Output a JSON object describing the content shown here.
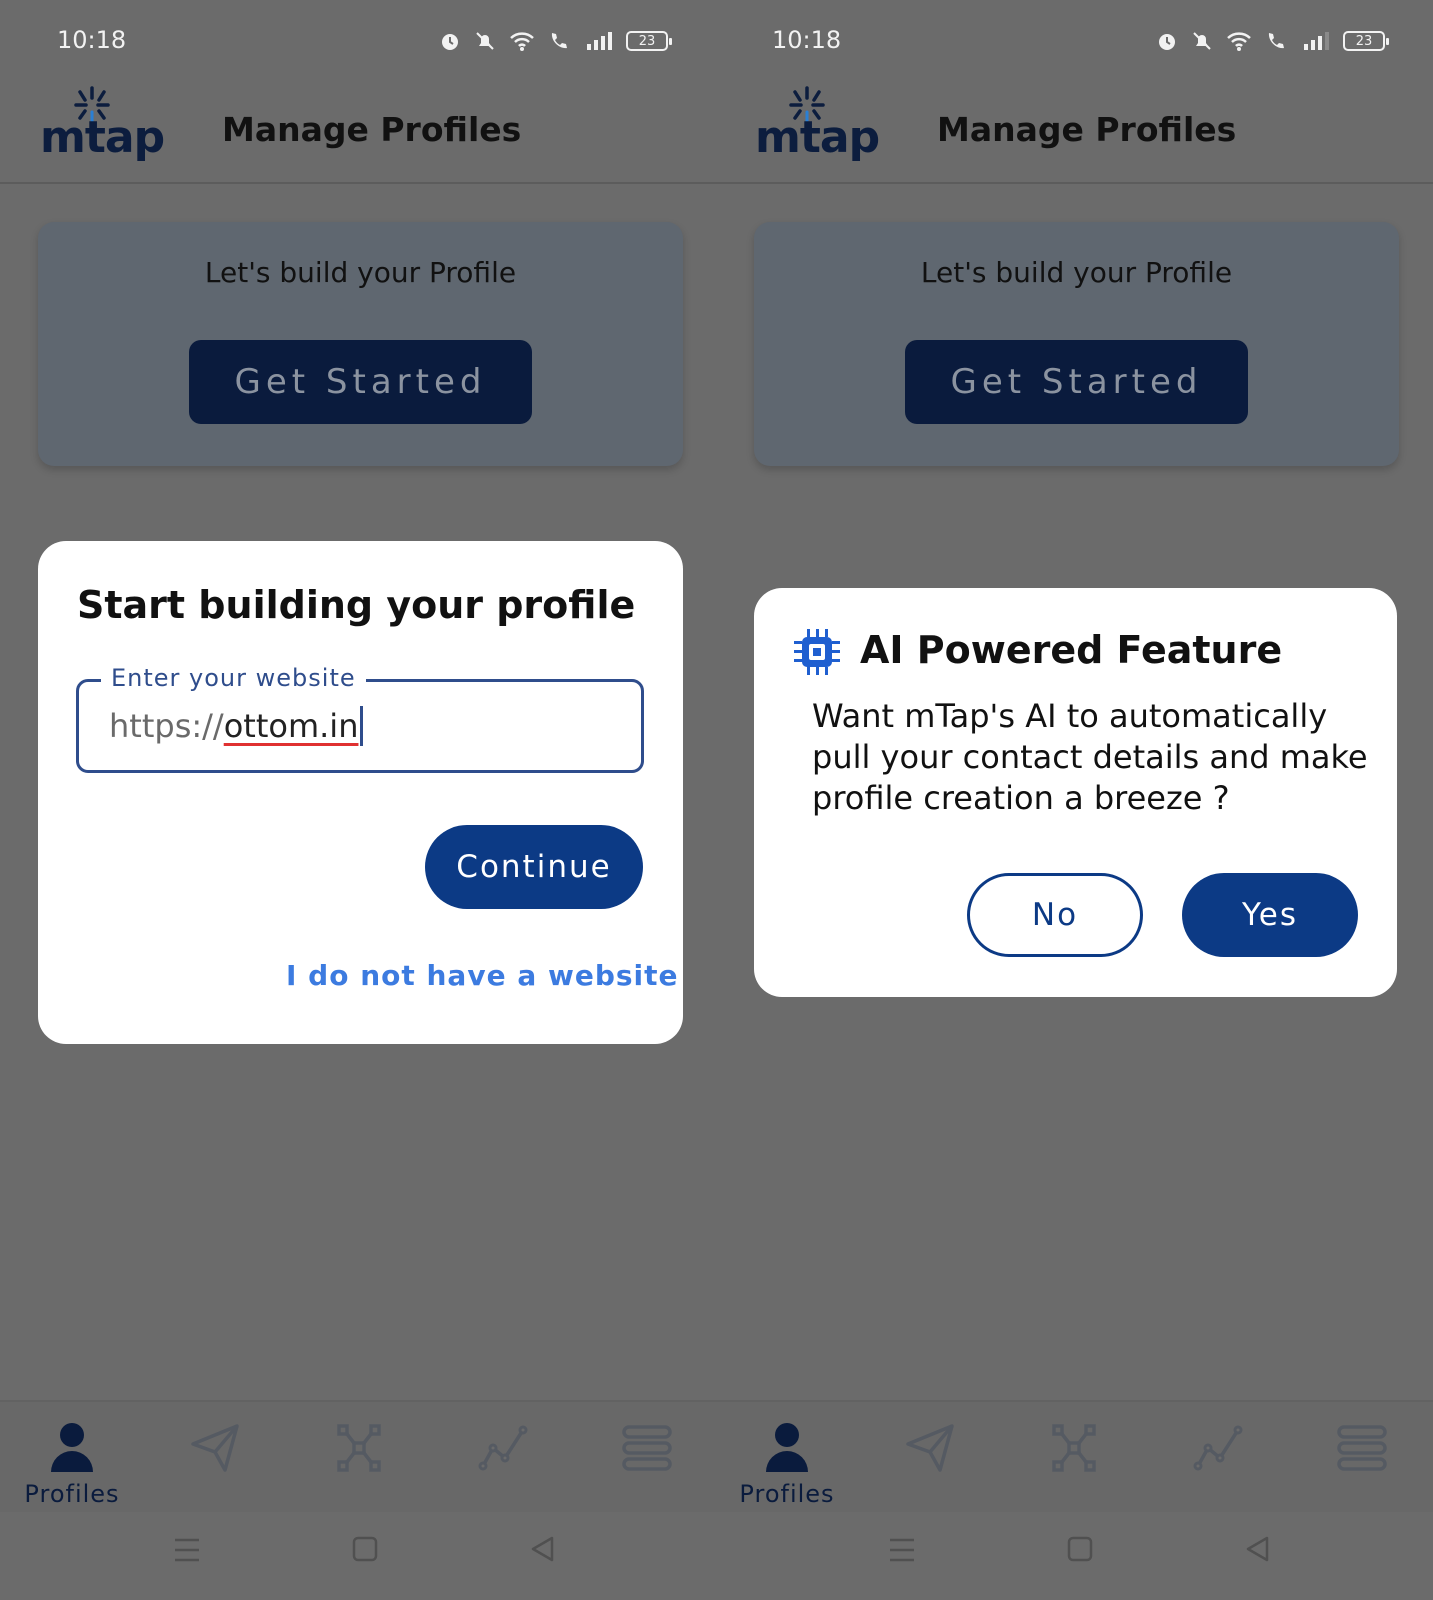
{
  "status": {
    "time": "10:18",
    "battery": "23"
  },
  "appbar": {
    "logo": "mtap",
    "title": "Manage Profiles"
  },
  "card": {
    "text": "Let's build your Profile",
    "button": "Get Started"
  },
  "website_dialog": {
    "title": "Start building your profile",
    "field_label": "Enter your website",
    "prefix": "https://",
    "value": "ottom.in",
    "continue_label": "Continue",
    "no_website_link": "I do not have a website"
  },
  "ai_dialog": {
    "title": "AI Powered Feature",
    "body": "Want mTap's AI to automatically pull your contact details and make profile creation a breeze ?",
    "no_label": "No",
    "yes_label": "Yes"
  },
  "bottom_nav": {
    "profiles_label": "Profiles"
  },
  "colors": {
    "brand_navy": "#0a1b3d",
    "primary_blue": "#0c3a85",
    "link_blue": "#3c7be0",
    "scrim": "#6b6b6b"
  }
}
